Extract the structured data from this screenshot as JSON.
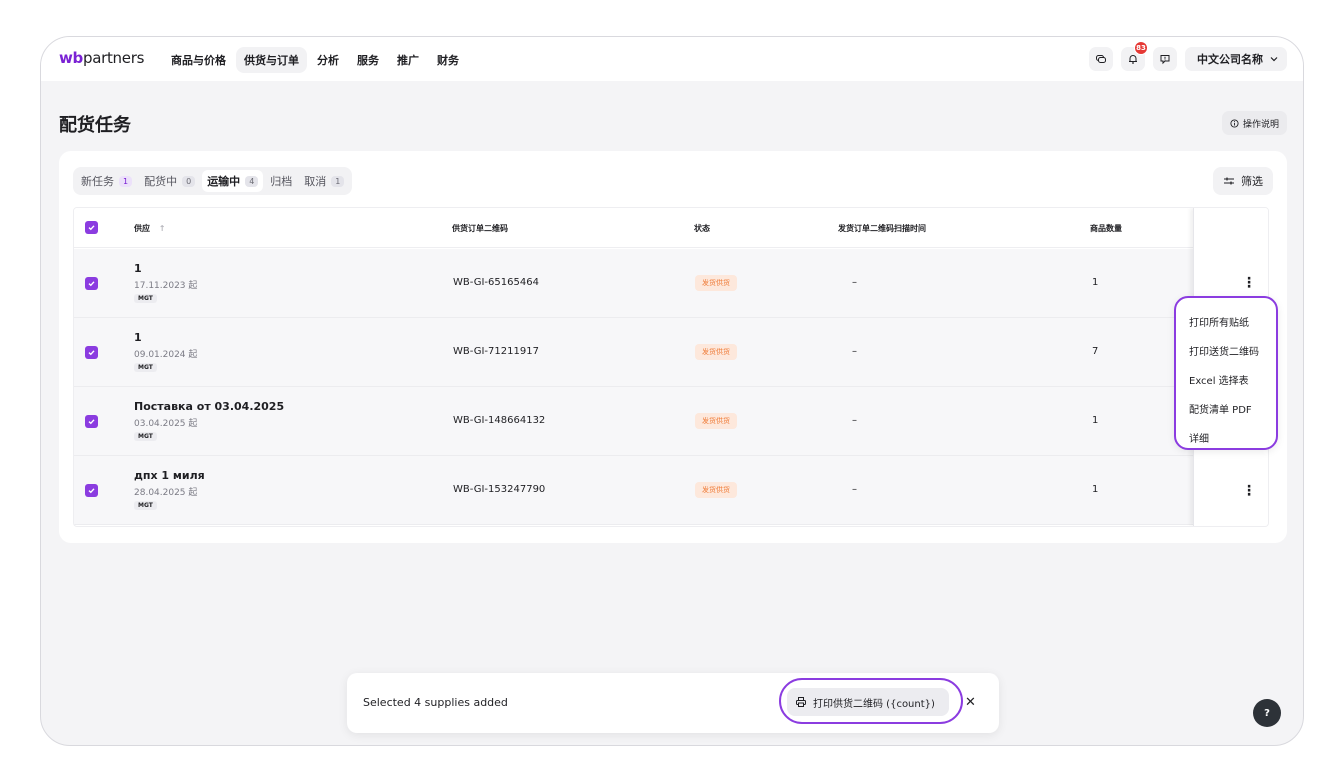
{
  "logo": {
    "wb": "wb",
    "partners": "partners"
  },
  "nav": {
    "items": [
      "商品与价格",
      "供货与订单",
      "分析",
      "服务",
      "推广",
      "财务"
    ],
    "active_index": 1
  },
  "header": {
    "notification_count": "83",
    "company_name": "中文公司名称"
  },
  "page": {
    "title": "配货任务",
    "help_label": "操作说明"
  },
  "tabs": [
    {
      "label": "新任务",
      "count": "1"
    },
    {
      "label": "配货中",
      "count": "0"
    },
    {
      "label": "运输中",
      "count": "4"
    },
    {
      "label": "归档",
      "count": ""
    },
    {
      "label": "取消",
      "count": "1"
    }
  ],
  "active_tab_index": 2,
  "filter_label": "筛选",
  "table": {
    "headers": {
      "supply": "供应",
      "qr": "供货订单二维码",
      "status": "状态",
      "scan_time": "发货订单二维码扫描时间",
      "qty": "商品数量"
    },
    "rows": [
      {
        "name": "1",
        "date": "17.11.2023 起",
        "tag": "MGT",
        "qr": "WB-GI-65165464",
        "status": "发货供货",
        "scan_time": "–",
        "qty": "1"
      },
      {
        "name": "1",
        "date": "09.01.2024 起",
        "tag": "MGT",
        "qr": "WB-GI-71211917",
        "status": "发货供货",
        "scan_time": "–",
        "qty": "7"
      },
      {
        "name": "Поставка от 03.04.2025",
        "date": "03.04.2025 起",
        "tag": "MGT",
        "qr": "WB-GI-148664132",
        "status": "发货供货",
        "scan_time": "–",
        "qty": "1"
      },
      {
        "name": "дпх 1 миля",
        "date": "28.04.2025 起",
        "tag": "MGT",
        "qr": "WB-GI-153247790",
        "status": "发货供货",
        "scan_time": "–",
        "qty": "1"
      }
    ]
  },
  "dropdown": {
    "items": [
      "打印所有贴纸",
      "打印送货二维码",
      "Excel 选择表",
      "配货清单 PDF",
      "详细"
    ]
  },
  "toast": {
    "text": "Selected 4 supplies added",
    "print_label": "打印供货二维码 ({count})"
  },
  "colors": {
    "accent": "#8b3ce0",
    "brand": "#7a21d4",
    "status_bg": "#fde8dc",
    "status_text": "#ef7a36"
  }
}
